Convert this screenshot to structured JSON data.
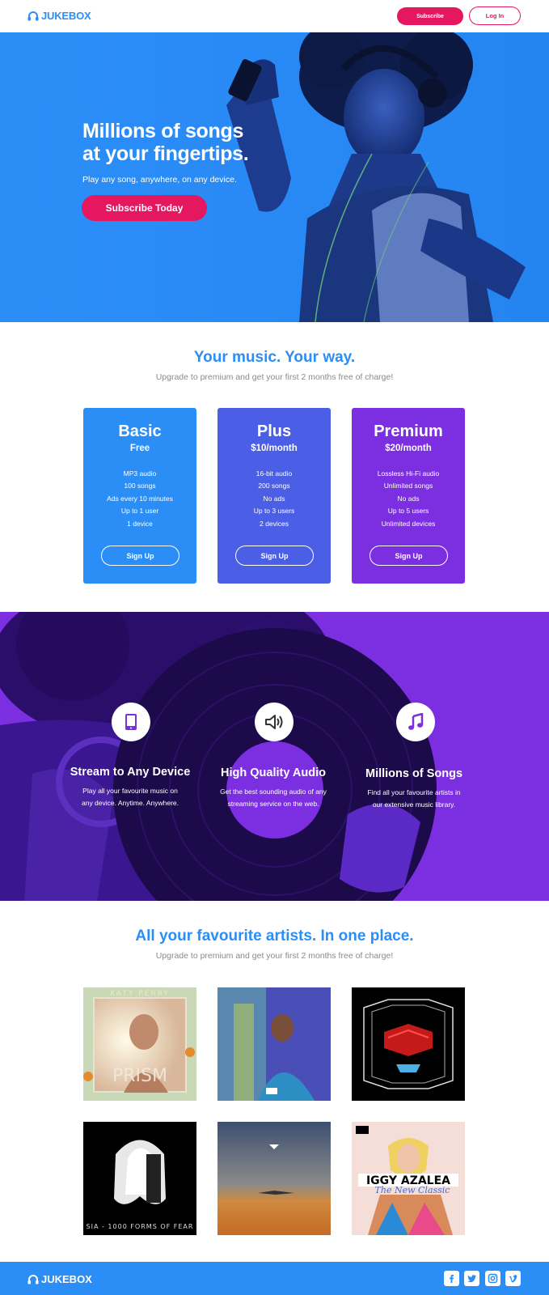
{
  "header": {
    "logo_text": "JUKEBOX",
    "subscribe_label": "Subscribe",
    "login_label": "Log In"
  },
  "hero": {
    "title_line1": "Millions of songs",
    "title_line2": "at your fingertips.",
    "subtitle": "Play any song, anywhere, on any device.",
    "cta_label": "Subscribe Today"
  },
  "plans_section": {
    "title": "Your music. Your way.",
    "subtitle": "Upgrade to premium and get your first 2 months free of charge!",
    "plans": [
      {
        "name": "Basic",
        "price": "Free",
        "color": "#2b8ef7",
        "features": [
          "MP3 audio",
          "100 songs",
          "Ads every 10 minutes",
          "Up to 1 user",
          "1 device"
        ],
        "button_label": "Sign Up"
      },
      {
        "name": "Plus",
        "price": "$10/month",
        "color": "#4b5fe6",
        "features": [
          "16-bit audio",
          "200 songs",
          "No ads",
          "Up to 3 users",
          "2 devices"
        ],
        "button_label": "Sign Up"
      },
      {
        "name": "Premium",
        "price": "$20/month",
        "color": "#7b2fe0",
        "features": [
          "Lossless Hi-Fi audio",
          "Unlimited songs",
          "No ads",
          "Up to 5 users",
          "Unlimited devices"
        ],
        "button_label": "Sign Up"
      }
    ]
  },
  "features": [
    {
      "icon": "tablet-icon",
      "title": "Stream to Any Device",
      "desc_line1": "Play all your favourite music on",
      "desc_line2": "any device. Anytime. Anywhere."
    },
    {
      "icon": "speaker-icon",
      "title": "High Quality Audio",
      "desc_line1": "Get the best sounding audio of any",
      "desc_line2": "streaming service on the web."
    },
    {
      "icon": "music-note-icon",
      "title": "Millions of Songs",
      "desc_line1": "Find all your favourite artists in",
      "desc_line2": "our extensive music library."
    }
  ],
  "artists_section": {
    "title": "All your favourite artists. In one place.",
    "subtitle": "Upgrade to premium and get your first 2 months free of charge!",
    "albums": [
      {
        "artist_text": "KATY PERRY",
        "album_text": "PRISM"
      },
      {
        "artist_text": "",
        "album_text": ""
      },
      {
        "artist_text": "",
        "album_text": ""
      },
      {
        "artist_text": "",
        "album_text": "SIA - 1000 FORMS OF FEAR"
      },
      {
        "artist_text": "",
        "album_text": ""
      },
      {
        "artist_text": "IGGY AZALEA",
        "album_text": "The New Classic"
      }
    ]
  },
  "footer": {
    "logo_text": "JUKEBOX",
    "social": [
      "facebook-icon",
      "twitter-icon",
      "instagram-icon",
      "vimeo-icon"
    ]
  },
  "colors": {
    "brand_blue": "#2b8ef7",
    "brand_pink": "#e5175f",
    "brand_purple": "#7b2fe0",
    "plus_blue": "#4b5fe6"
  }
}
